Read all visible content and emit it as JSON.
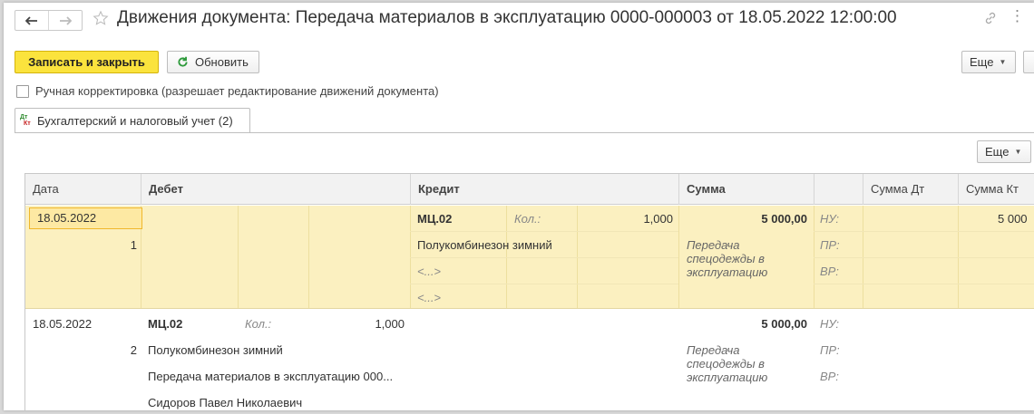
{
  "window": {
    "title": "Движения документа: Передача материалов в эксплуатацию 0000-000003 от 18.05.2022 12:00:00"
  },
  "toolbar": {
    "save_close_label": "Записать и закрыть",
    "refresh_label": "Обновить",
    "more_label": "Еще"
  },
  "manual_correction": {
    "label": "Ручная корректировка (разрешает редактирование движений документа)",
    "checked": false
  },
  "tabs": [
    {
      "label": "Бухгалтерский и налоговый учет (2)",
      "icon": "dt-kt-icon",
      "active": true
    }
  ],
  "grid": {
    "more_label": "Еще",
    "columns": [
      "Дата",
      "Дебет",
      "Кредит",
      "Сумма",
      "Сумма Дт",
      "Сумма Кт"
    ],
    "rows": [
      {
        "date": "18.05.2022",
        "number": "1",
        "debit": {
          "account": "",
          "qty_label": "",
          "qty": "",
          "lines": []
        },
        "credit": {
          "account": "МЦ.02",
          "qty_label": "Кол.:",
          "qty": "1,000",
          "lines": [
            "Полукомбинезон зимний",
            "<...>",
            "<...>"
          ]
        },
        "sum": "5 000,00",
        "content": "Передача спецодежды в эксплуатацию",
        "tax_labels": [
          "НУ:",
          "ПР:",
          "ВР:"
        ],
        "sum_dt": "",
        "sum_kt": "5 000"
      },
      {
        "date": "18.05.2022",
        "number": "2",
        "debit": {
          "account": "МЦ.02",
          "qty_label": "Кол.:",
          "qty": "1,000",
          "lines": [
            "Полукомбинезон зимний",
            "Передача материалов в эксплуатацию 000...",
            "Сидоров Павел Николаевич"
          ]
        },
        "credit": {
          "account": "",
          "qty_label": "",
          "qty": "",
          "lines": []
        },
        "sum": "5 000,00",
        "content": "Передача спецодежды в эксплуатацию",
        "tax_labels": [
          "НУ:",
          "ПР:",
          "ВР:"
        ],
        "sum_dt": "",
        "sum_kt": ""
      }
    ]
  },
  "colors": {
    "accent_yellow": "#fbe33d",
    "selected_row": "#fbf0c0",
    "selected_cell_border": "#f0b72a"
  }
}
